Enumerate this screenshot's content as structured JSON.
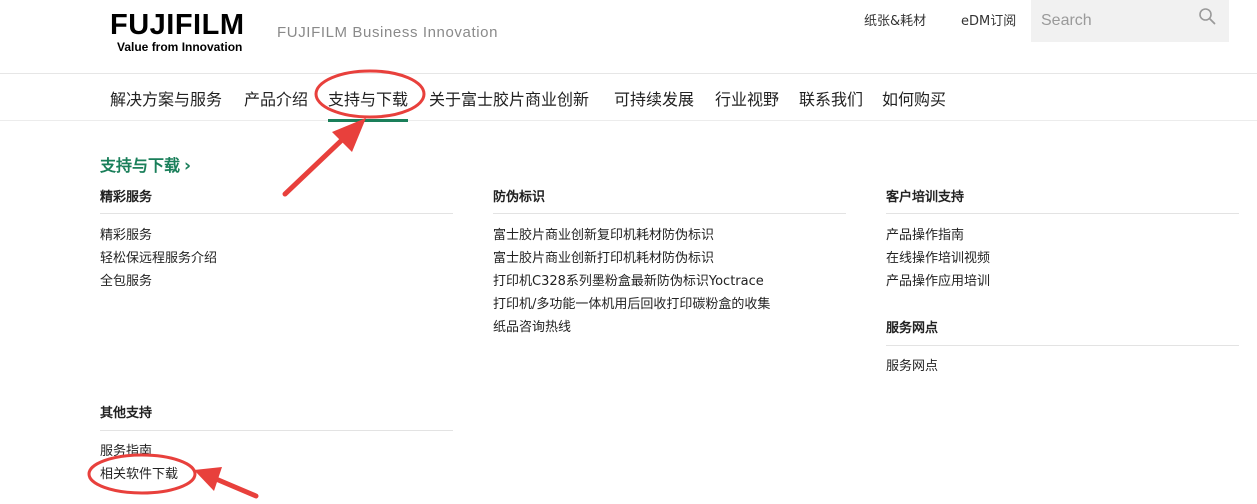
{
  "header": {
    "logo_text": "FUJIFILM",
    "logo_tagline": "Value from Innovation",
    "brand_sub": "FUJIFILM Business Innovation",
    "util_links": [
      "纸张&耗材",
      "eDM订阅"
    ],
    "search": {
      "placeholder": "Search",
      "value": ""
    }
  },
  "nav": {
    "items": [
      "解决方案与服务",
      "产品介绍",
      "支持与下载",
      "关于富士胶片商业创新",
      "可持续发展",
      "行业视野",
      "联系我们",
      "如何购买"
    ],
    "active_index": 2
  },
  "menu": {
    "crumb": "支持与下载",
    "sections": [
      {
        "title": "精彩服务",
        "links": [
          "精彩服务",
          "轻松保远程服务介绍",
          "全包服务"
        ]
      },
      {
        "title": "防伪标识",
        "links": [
          "富士胶片商业创新复印机耗材防伪标识",
          "富士胶片商业创新打印机耗材防伪标识",
          "打印机C328系列墨粉盒最新防伪标识Yoctrace",
          "打印机/多功能一体机用后回收打印碳粉盒的收集",
          "纸品咨询热线"
        ]
      },
      {
        "title": "客户培训支持",
        "links": [
          "产品操作指南",
          "在线操作培训视频",
          "产品操作应用培训"
        ]
      },
      {
        "title": "服务网点",
        "links": [
          "服务网点"
        ]
      },
      {
        "title": "其他支持",
        "links": [
          "服务指南",
          "相关软件下载"
        ]
      }
    ]
  },
  "colors": {
    "accent": "#1a7f5a",
    "annotation": "#e8403c"
  }
}
